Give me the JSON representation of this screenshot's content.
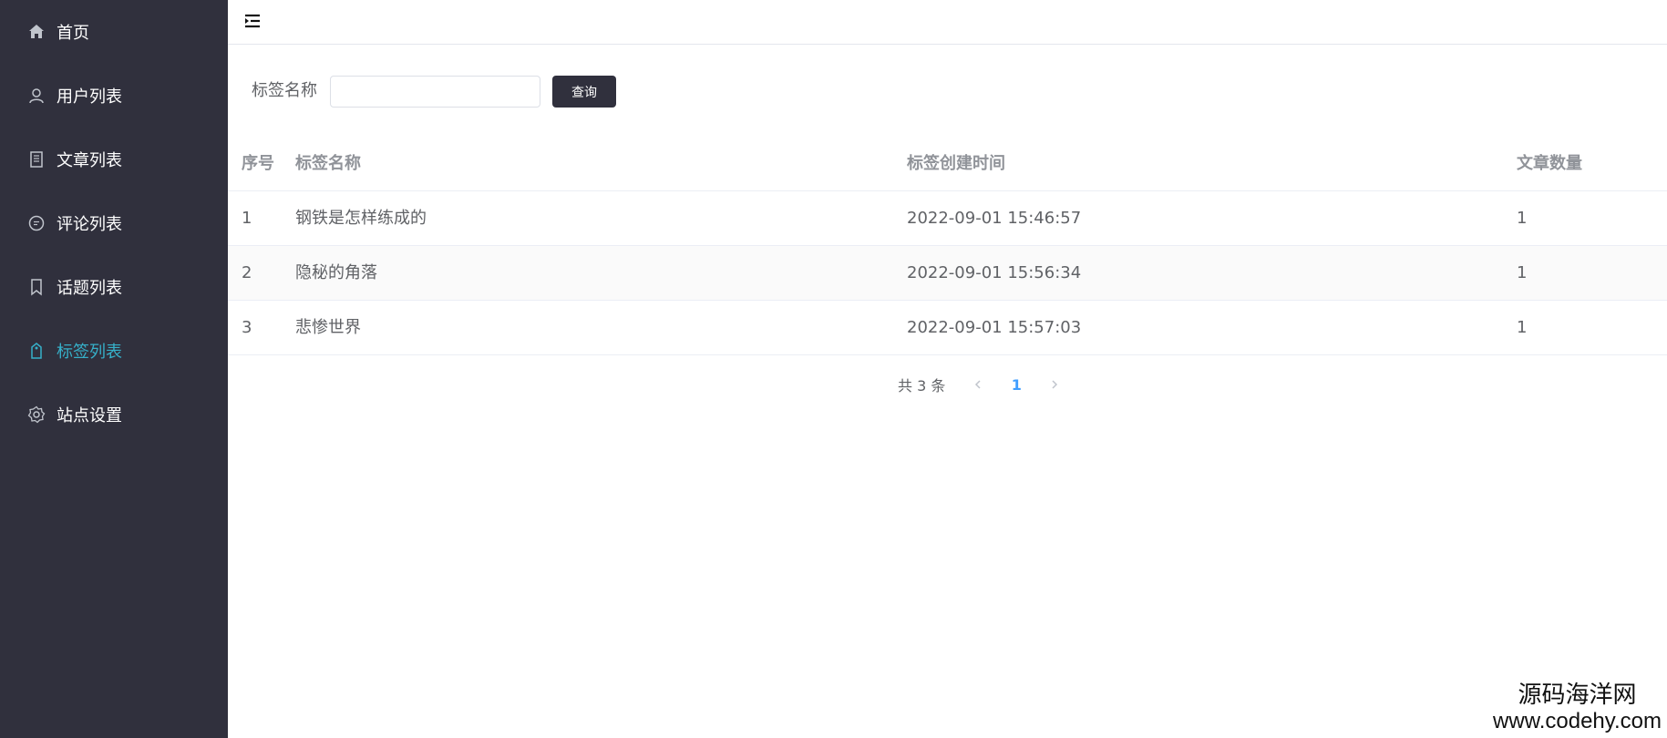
{
  "sidebar": {
    "items": [
      {
        "label": "首页",
        "icon": "home-icon"
      },
      {
        "label": "用户列表",
        "icon": "user-icon"
      },
      {
        "label": "文章列表",
        "icon": "document-icon"
      },
      {
        "label": "评论列表",
        "icon": "comment-icon"
      },
      {
        "label": "话题列表",
        "icon": "bookmark-icon"
      },
      {
        "label": "标签列表",
        "icon": "tag-icon",
        "active": true
      },
      {
        "label": "站点设置",
        "icon": "gear-icon"
      }
    ],
    "bg_color": "#30303d",
    "active_color": "#36b0c9"
  },
  "topbar": {
    "collapse_icon": "menu-fold-icon"
  },
  "filter": {
    "label": "标签名称",
    "input_value": "",
    "query_label": "查询"
  },
  "table": {
    "columns": [
      "序号",
      "标签名称",
      "标签创建时间",
      "文章数量"
    ],
    "rows": [
      [
        "1",
        "钢铁是怎样练成的",
        "2022-09-01 15:46:57",
        "1"
      ],
      [
        "2",
        "隐秘的角落",
        "2022-09-01 15:56:34",
        "1"
      ],
      [
        "3",
        "悲惨世界",
        "2022-09-01 15:57:03",
        "1"
      ]
    ]
  },
  "pagination": {
    "total_text": "共 3 条",
    "current_page": "1",
    "prev_icon": "chevron-left-icon",
    "next_icon": "chevron-right-icon"
  },
  "watermark": {
    "cn": "源码海洋网",
    "en": "www.codehy.com"
  }
}
